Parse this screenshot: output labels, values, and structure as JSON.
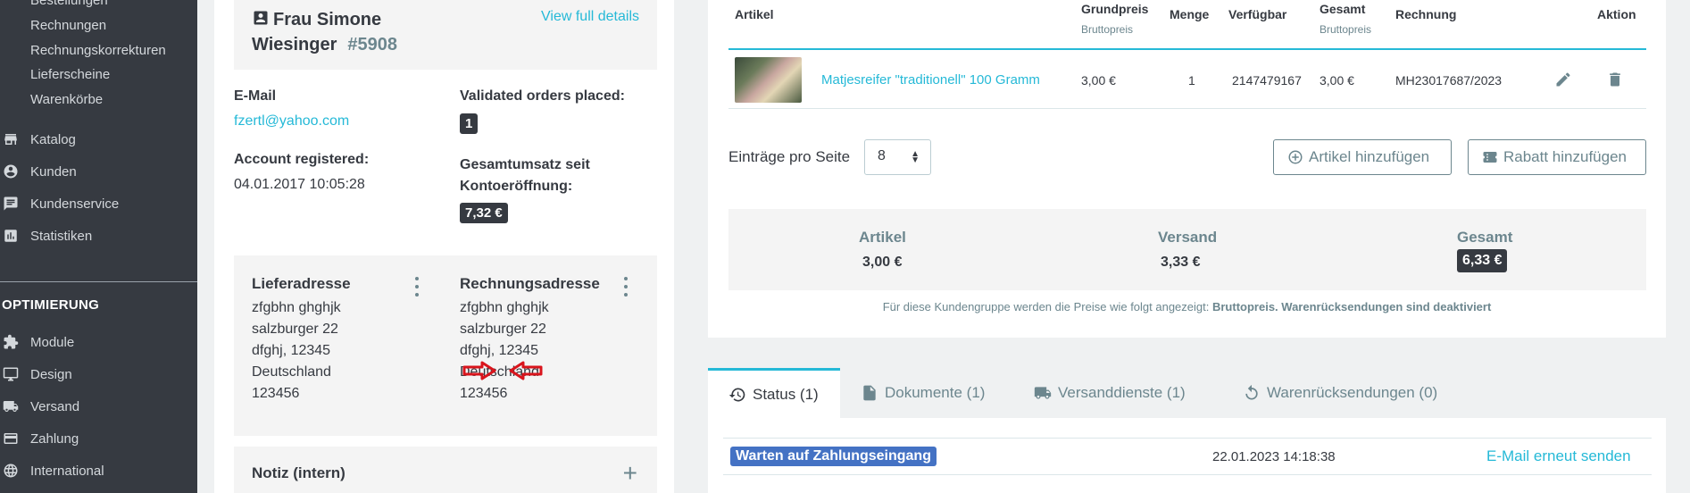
{
  "sidebar": {
    "sub_items": [
      "Bestellungen",
      "Rechnungen",
      "Rechnungskorrekturen",
      "Lieferscheine",
      "Warenkörbe"
    ],
    "nav_items": [
      {
        "label": "Katalog",
        "icon": "store-icon"
      },
      {
        "label": "Kunden",
        "icon": "account-circle-icon"
      },
      {
        "label": "Kundenservice",
        "icon": "chat-icon"
      },
      {
        "label": "Statistiken",
        "icon": "bar-chart-icon"
      }
    ],
    "section_title": "OPTIMIERUNG",
    "opt_items": [
      {
        "label": "Module",
        "icon": "puzzle-icon"
      },
      {
        "label": "Design",
        "icon": "desktop-icon"
      },
      {
        "label": "Versand",
        "icon": "truck-icon"
      },
      {
        "label": "Zahlung",
        "icon": "credit-card-icon"
      },
      {
        "label": "International",
        "icon": "globe-icon"
      }
    ]
  },
  "customer": {
    "name_line1": "Frau Simone",
    "name_line2": "Wiesinger",
    "id": "#5908",
    "view_details": "View full details",
    "email_label": "E-Mail",
    "email": "fzertl@yahoo.com",
    "orders_label": "Validated orders placed:",
    "orders_count": "1",
    "registered_label": "Account registered:",
    "registered_value": "04.01.2017 10:05:28",
    "revenue_label_1": "Gesamtumsatz seit",
    "revenue_label_2": "Kontoeröffnung:",
    "revenue_value": "7,32 €"
  },
  "delivery_address": {
    "title": "Lieferadresse",
    "lines": [
      "zfgbhn ghghjk",
      "salzburger 22",
      "dfghj, 12345",
      "Deutschland",
      "123456"
    ]
  },
  "billing_address": {
    "title": "Rechnungsadresse",
    "lines": [
      "zfgbhn ghghjk",
      "salzburger 22",
      "dfghj, 12345",
      "Deutschland",
      "123456"
    ]
  },
  "note": {
    "title": "Notiz (intern)"
  },
  "products_table": {
    "headers": {
      "artikel": "Artikel",
      "grundpreis": "Grundpreis",
      "grundpreis_sub": "Bruttopreis",
      "menge": "Menge",
      "verfuegbar": "Verfügbar",
      "gesamt": "Gesamt",
      "gesamt_sub": "Bruttopreis",
      "rechnung": "Rechnung",
      "aktion": "Aktion"
    },
    "rows": [
      {
        "name": "Matjesreifer \"traditionell\" 100 Gramm",
        "unit_price": "3,00 €",
        "quantity": "1",
        "available": "2147479167",
        "total": "3,00 €",
        "invoice": "MH23017687/2023"
      }
    ]
  },
  "pagination": {
    "label": "Einträge pro Seite",
    "value": "8"
  },
  "buttons": {
    "add_product": "Artikel hinzufügen",
    "add_discount": "Rabatt hinzufügen"
  },
  "summary": {
    "artikel_label": "Artikel",
    "artikel_value": "3,00 €",
    "versand_label": "Versand",
    "versand_value": "3,33 €",
    "gesamt_label": "Gesamt",
    "gesamt_value": "6,33 €"
  },
  "footnote": {
    "prefix": "Für diese Kundengruppe werden die Preise wie folgt angezeigt: ",
    "price_type": "Bruttopreis",
    "returns": "Warenrücksendungen sind deaktiviert"
  },
  "tabs": [
    {
      "label": "Status (1)",
      "icon": "history-icon",
      "active": true
    },
    {
      "label": "Dokumente (1)",
      "icon": "document-icon",
      "active": false
    },
    {
      "label": "Versanddienste (1)",
      "icon": "truck-icon",
      "active": false
    },
    {
      "label": "Warenrücksendungen (0)",
      "icon": "undo-icon",
      "active": false
    }
  ],
  "status": {
    "badge": "Warten auf Zahlungseingang",
    "date": "22.01.2023 14:18:38",
    "resend": "E-Mail erneut senden"
  },
  "colors": {
    "accent": "#25b9d7",
    "sidebar_bg": "#363a41",
    "status_blue": "#4472c4",
    "annotation_red": "#d9141c"
  }
}
